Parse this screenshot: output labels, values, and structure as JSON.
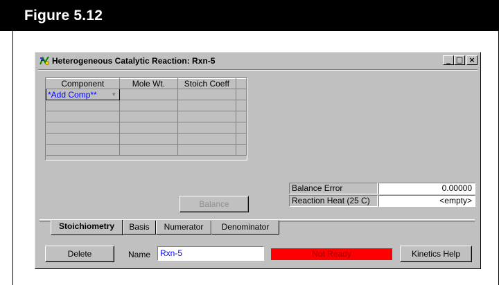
{
  "figure": {
    "title": "Figure 5.12"
  },
  "window": {
    "title": "Heterogeneous Catalytic Reaction: Rxn-5",
    "controls": [
      "_",
      "□",
      "×"
    ]
  },
  "grid": {
    "columns": [
      "Component",
      "Mole Wt.",
      "Stoich Coeff"
    ],
    "first_row": [
      "*Add Comp**",
      "",
      ""
    ],
    "empty_rows": 5
  },
  "buttons": {
    "balance": "Balance",
    "delete": "Delete",
    "kinetics_help": "Kinetics Help"
  },
  "properties": [
    {
      "label": "Balance Error",
      "value": "0.00000"
    },
    {
      "label": "Reaction Heat (25 C)",
      "value": "<empty>"
    }
  ],
  "tabs": [
    "Stoichiometry",
    "Basis",
    "Numerator",
    "Denominator"
  ],
  "active_tab": "Stoichiometry",
  "name_field": {
    "label": "Name",
    "value": "Rxn-5"
  },
  "status": {
    "text": "Not Ready",
    "color": "#ff0000"
  }
}
